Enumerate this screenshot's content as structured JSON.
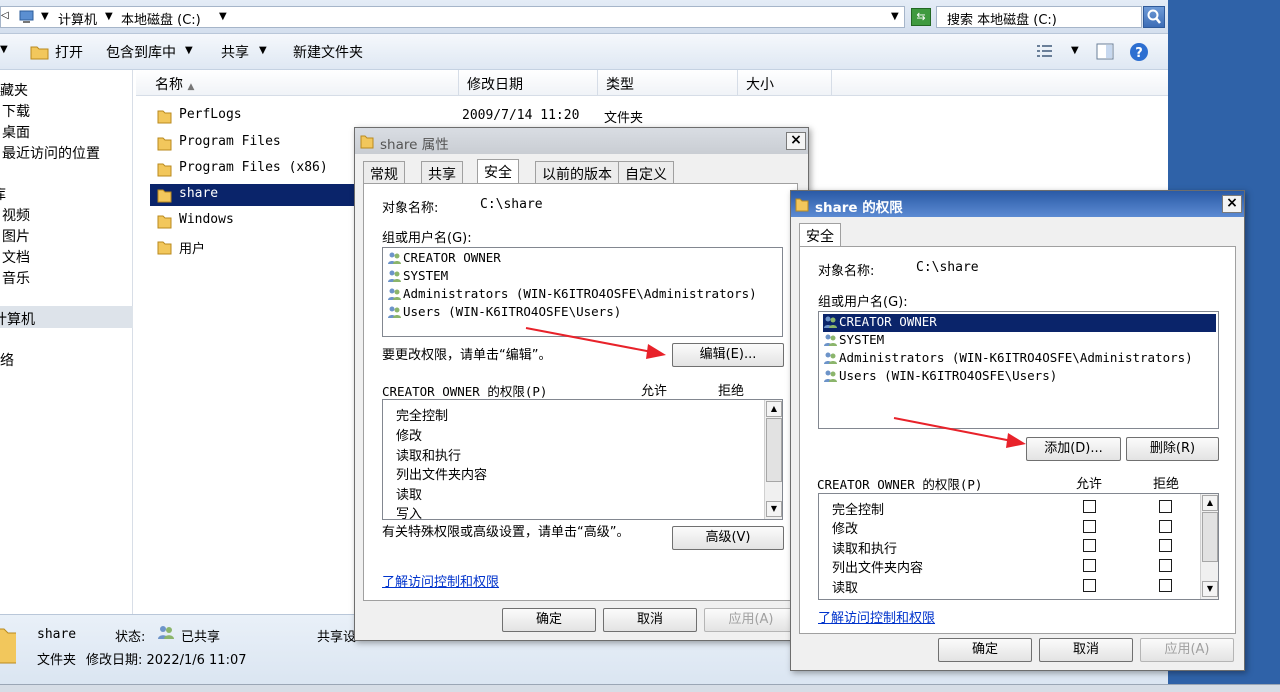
{
  "address": {
    "crumbs": [
      "计算机",
      "本地磁盘 (C:)"
    ],
    "search_placeholder": "搜索 本地磁盘 (C:)"
  },
  "toolbar": {
    "open": "打开",
    "include_library": "包含到库中",
    "share": "共享",
    "new_folder": "新建文件夹"
  },
  "nav": {
    "favorites": "收藏夹",
    "downloads": "下载",
    "desktop": "桌面",
    "recent": "最近访问的位置",
    "libraries": "库",
    "videos": "视频",
    "pictures": "图片",
    "documents": "文档",
    "music": "音乐",
    "computer": "计算机",
    "network": "网络"
  },
  "columns": {
    "name": "名称",
    "modified": "修改日期",
    "type": "类型",
    "size": "大小"
  },
  "files": [
    {
      "name": "PerfLogs",
      "modified": "2009/7/14 11:20",
      "type": "文件夹"
    },
    {
      "name": "Program Files"
    },
    {
      "name": "Program Files (x86)"
    },
    {
      "name": "share"
    },
    {
      "name": "Windows"
    },
    {
      "name": "用户"
    }
  ],
  "status": {
    "name": "share",
    "state_label": "状态:",
    "state_value": "已共享",
    "type": "文件夹",
    "modified": "修改日期: 2022/1/6 11:07",
    "share_label": "共享设"
  },
  "props": {
    "title": "share 属性",
    "tabs": [
      "常规",
      "共享",
      "安全",
      "以前的版本",
      "自定义"
    ],
    "object_label": "对象名称:",
    "object_value": "C:\\share",
    "group_label": "组或用户名(G):",
    "users": [
      "CREATOR OWNER",
      "SYSTEM",
      "Administrators (WIN-K6ITRO4OSFE\\Administrators)",
      "Users (WIN-K6ITRO4OSFE\\Users)"
    ],
    "change_hint": "要更改权限，请单击“编辑”。",
    "edit_button": "编辑(E)...",
    "perm_label": "CREATOR OWNER 的权限(P)",
    "allow": "允许",
    "deny": "拒绝",
    "perms": [
      "完全控制",
      "修改",
      "读取和执行",
      "列出文件夹内容",
      "读取",
      "写入"
    ],
    "advanced_hint": "有关特殊权限或高级设置，请单击“高级”。",
    "advanced_button": "高级(V)",
    "learn_link": "了解访问控制和权限",
    "ok": "确定",
    "cancel": "取消",
    "apply": "应用(A)"
  },
  "perm_dialog": {
    "title": "share 的权限",
    "tab": "安全",
    "object_label": "对象名称:",
    "object_value": "C:\\share",
    "group_label": "组或用户名(G):",
    "users": [
      "CREATOR OWNER",
      "SYSTEM",
      "Administrators (WIN-K6ITRO4OSFE\\Administrators)",
      "Users (WIN-K6ITRO4OSFE\\Users)"
    ],
    "add_button": "添加(D)...",
    "remove_button": "删除(R)",
    "perm_label": "CREATOR OWNER 的权限(P)",
    "allow": "允许",
    "deny": "拒绝",
    "perms": [
      "完全控制",
      "修改",
      "读取和执行",
      "列出文件夹内容",
      "读取"
    ],
    "learn_link": "了解访问控制和权限",
    "ok": "确定",
    "cancel": "取消",
    "apply": "应用(A)"
  },
  "colors": {
    "selection": "#0a246a",
    "arrow": "#e8222a",
    "link": "#0033cc"
  }
}
